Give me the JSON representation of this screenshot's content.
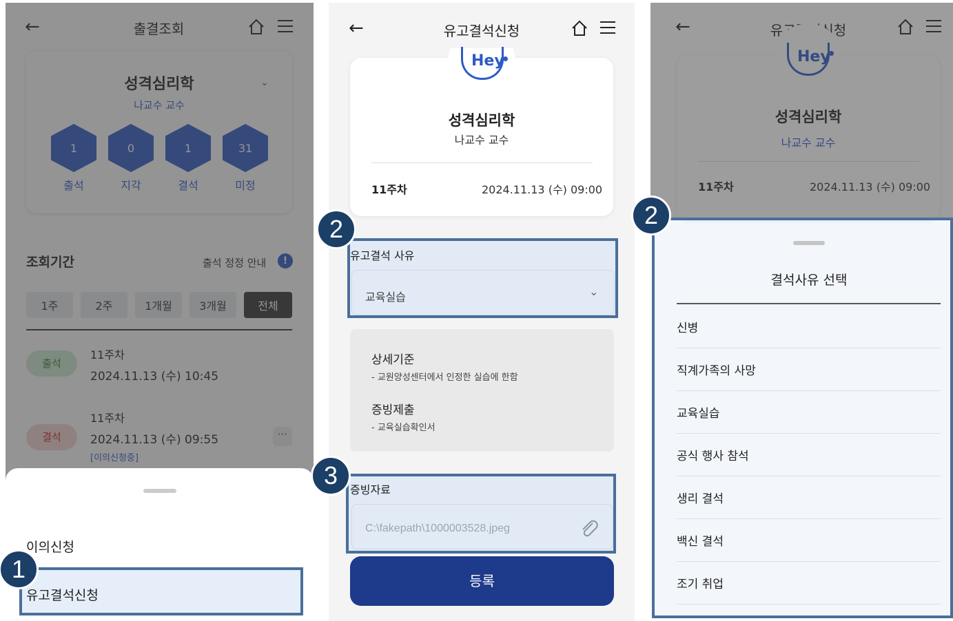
{
  "left": {
    "title": "출결조회",
    "course": "성격심리학",
    "professor": "나교수 교수",
    "stats": [
      {
        "value": "1",
        "label": "출석"
      },
      {
        "value": "0",
        "label": "지각"
      },
      {
        "value": "1",
        "label": "결석"
      },
      {
        "value": "31",
        "label": "미정"
      }
    ],
    "period_label": "조회기간",
    "notice": "출석 정정 안내",
    "periods": [
      "1주",
      "2주",
      "1개월",
      "3개월",
      "전체"
    ],
    "records": [
      {
        "status": "출석",
        "week": "11주차",
        "datetime": "2024.11.13 (수) 10:45"
      },
      {
        "status": "결석",
        "week": "11주차",
        "datetime": "2024.11.13 (수) 09:55",
        "note": "[이의신청중]"
      }
    ],
    "sheet_items": [
      "이의신청",
      "유고결석신청"
    ],
    "badge": "1"
  },
  "middle": {
    "title": "유고결석신청",
    "logo": "Hey",
    "course": "성격심리학",
    "professor": "나교수 교수",
    "week": "11주차",
    "datetime": "2024.11.13 (수) 09:00",
    "reason_label": "유고결석 사유",
    "reason_value": "교육실습",
    "criteria_title": "상세기준",
    "criteria_text": "- 교원양성센터에서 인정한 실습에 한함",
    "proof_title": "증빙제출",
    "proof_text": "- 교육실습확인서",
    "file_label": "증빙자료",
    "file_value": "C:\\fakepath\\1000003528.jpeg",
    "submit": "등록",
    "badge2": "2",
    "badge3": "3"
  },
  "right": {
    "title": "유고결석신청",
    "logo": "Hey",
    "course": "성격심리학",
    "professor": "나교수 교수",
    "week": "11주차",
    "datetime": "2024.11.13 (수) 09:00",
    "sheet_title": "결석사유 선택",
    "reasons": [
      "신병",
      "직계가족의 사망",
      "교육실습",
      "공식 행사 참석",
      "생리 결석",
      "백신 결석",
      "조기 취업"
    ],
    "badge": "2"
  },
  "colors": {
    "accent": "#2d5ac8",
    "submit": "#1e3a8a",
    "highlight": "#4a6f9a",
    "badge": "#1b3f66"
  }
}
